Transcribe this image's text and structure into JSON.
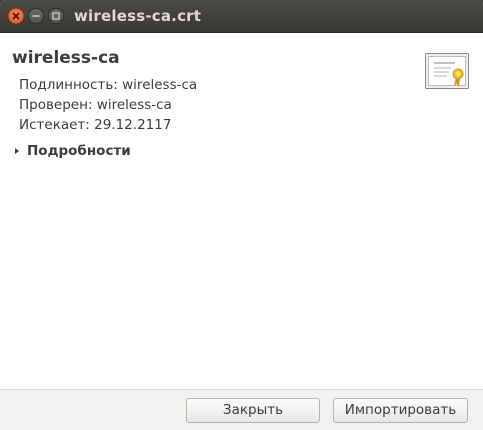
{
  "window": {
    "title": "wireless-ca.crt"
  },
  "certificate": {
    "name": "wireless-ca",
    "issued_to": "Подлинность: wireless-ca",
    "verified_by": "Проверен: wireless-ca",
    "expires": "Истекает: 29.12.2117",
    "details_label": "Подробности",
    "icon": "certificate-icon"
  },
  "buttons": {
    "close_label": "Закрыть",
    "import_label": "Импортировать"
  },
  "colors": {
    "titlebar": "#3c3b37",
    "close_button": "#e05a2b",
    "text": "#3c3c3c",
    "footer": "#f2f1f0"
  }
}
